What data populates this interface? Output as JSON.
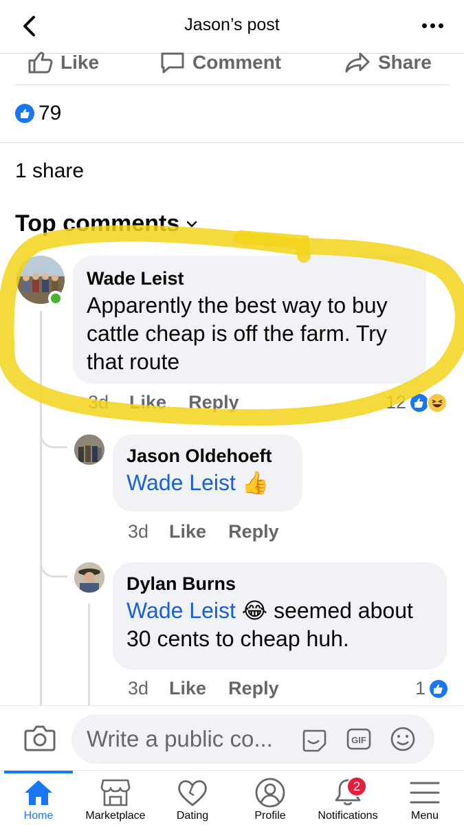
{
  "header": {
    "title": "Jason’s post",
    "back_icon": "chevron-left-icon",
    "more_icon": "more-dots-icon"
  },
  "actions": {
    "like": "Like",
    "comment": "Comment",
    "share": "Share"
  },
  "reactions": {
    "count": "79"
  },
  "shares": "1 share",
  "top_comments_label": "Top comments",
  "comments": [
    {
      "author": "Wade Leist",
      "text": "Apparently the best way to buy cattle cheap is off the farm. Try that route",
      "age": "3d",
      "like": "Like",
      "reply": "Reply",
      "reaction_count": "12"
    },
    {
      "author": "Jason Oldehoeft",
      "mention": "Wade Leist",
      "emoji": "👍",
      "age": "3d",
      "like": "Like",
      "reply": "Reply"
    },
    {
      "author": "Dylan Burns",
      "mention": "Wade Leist",
      "emoji": "😂",
      "text_line1": "seemed about",
      "text_line2": "30 cents to cheap huh.",
      "age": "3d",
      "like": "Like",
      "reply": "Reply",
      "reaction_count": "1"
    }
  ],
  "composer": {
    "placeholder": "Write a public co..."
  },
  "tabs": [
    {
      "label": "Home",
      "icon": "home-icon",
      "active": true
    },
    {
      "label": "Marketplace",
      "icon": "marketplace-icon"
    },
    {
      "label": "Dating",
      "icon": "dating-heart-icon"
    },
    {
      "label": "Profile",
      "icon": "profile-icon"
    },
    {
      "label": "Notifications",
      "icon": "bell-icon",
      "badge": "2"
    },
    {
      "label": "Menu",
      "icon": "menu-icon"
    }
  ],
  "colors": {
    "accent": "#1877f2",
    "highlight": "#f2d41a",
    "badge": "#e41e3f",
    "online": "#42b72a",
    "mention": "#1a5fd6"
  }
}
